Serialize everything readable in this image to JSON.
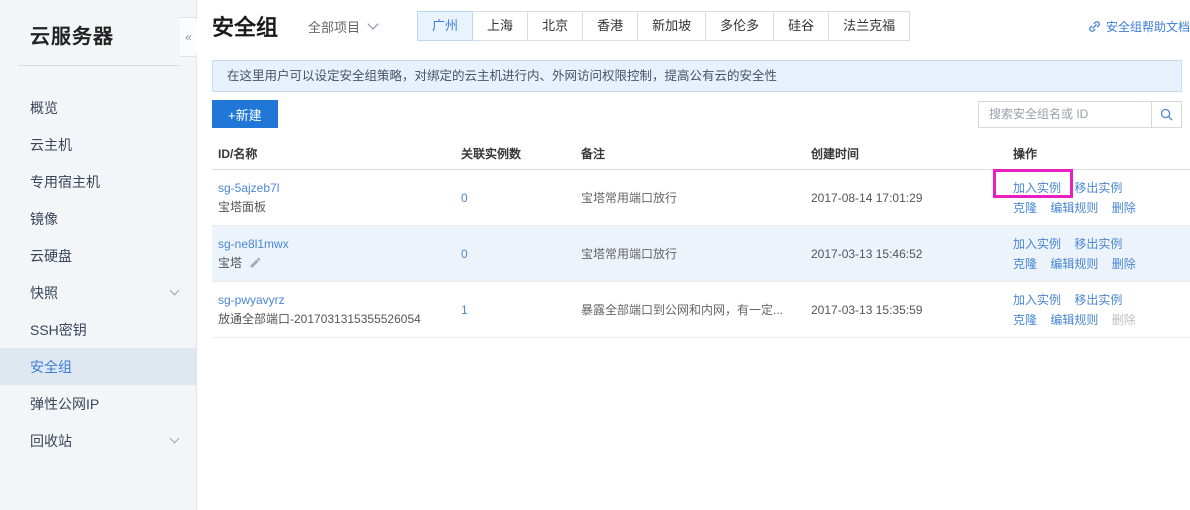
{
  "sidebar": {
    "title": "云服务器",
    "collapse_icon": "«",
    "items": [
      {
        "label": "概览"
      },
      {
        "label": "云主机"
      },
      {
        "label": "专用宿主机"
      },
      {
        "label": "镜像"
      },
      {
        "label": "云硬盘"
      },
      {
        "label": "快照",
        "expandable": true
      },
      {
        "label": "SSH密钥"
      },
      {
        "label": "安全组",
        "active": true
      },
      {
        "label": "弹性公网IP"
      },
      {
        "label": "回收站",
        "expandable": true
      }
    ]
  },
  "header": {
    "title": "安全组",
    "project_filter": "全部项目",
    "regions": [
      "广州",
      "上海",
      "北京",
      "香港",
      "新加坡",
      "多伦多",
      "硅谷",
      "法兰克福"
    ],
    "active_region": "广州",
    "help_link": "安全组帮助文档"
  },
  "banner": {
    "text": "在这里用户可以设定安全组策略，对绑定的云主机进行内、外网访问权限控制，提高公有云的安全性"
  },
  "toolbar": {
    "create_label": "+新建",
    "search_placeholder": "搜索安全组名或 ID"
  },
  "table": {
    "columns": [
      "ID/名称",
      "关联实例数",
      "备注",
      "创建时间",
      "操作"
    ],
    "actions": {
      "join": "加入实例",
      "remove": "移出实例",
      "clone": "克隆",
      "edit": "编辑规则",
      "delete": "删除"
    },
    "rows": [
      {
        "id": "sg-5ajzeb7l",
        "name": "宝塔面板",
        "instances": "0",
        "remark": "宝塔常用端口放行",
        "created": "2017-08-14 17:01:29"
      },
      {
        "id": "sg-ne8l1mwx",
        "name": "宝塔",
        "instances": "0",
        "remark": "宝塔常用端口放行",
        "created": "2017-03-13 15:46:52",
        "name_editable": true
      },
      {
        "id": "sg-pwyavyrz",
        "name": "放通全部端口-2017031315355526054",
        "instances": "1",
        "remark": "暴露全部端口到公网和内网，有一定...",
        "created": "2017-03-13 15:35:59",
        "delete_disabled": true
      }
    ]
  },
  "annotation": {
    "highlight_target": "加入实例",
    "color": "#ea1fc3"
  }
}
